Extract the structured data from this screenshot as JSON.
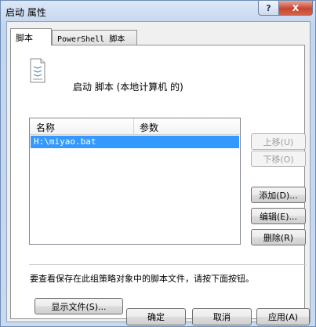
{
  "window": {
    "title": "启动 属性",
    "help_label": "?",
    "close_label": "X"
  },
  "tabs": [
    {
      "label": "脚本",
      "active": true
    },
    {
      "label": "PowerShell 脚本",
      "active": false
    }
  ],
  "script_panel": {
    "heading": "启动 脚本 (本地计算机 的)",
    "columns": [
      "名称",
      "参数"
    ],
    "rows": [
      {
        "name": "H:\\miyao.bat",
        "params": "",
        "selected": true
      }
    ],
    "buttons": {
      "up": "上移(U)",
      "down": "下移(O)",
      "add": "添加(D)...",
      "edit": "编辑(E)...",
      "remove": "删除(R)"
    },
    "info_text": "要查看保存在此组策略对象中的脚本文件，请按下面按钮。",
    "show_files": "显示文件(S)..."
  },
  "footer": {
    "ok": "确定",
    "cancel": "取消",
    "apply": "应用(A)"
  },
  "colors": {
    "selection": "#3399ff",
    "close_button": "#c74631"
  }
}
